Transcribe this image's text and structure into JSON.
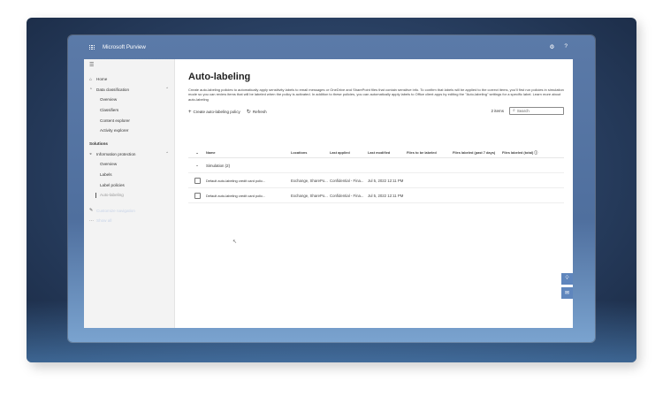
{
  "app": {
    "title": "Microsoft Purview",
    "settings_icon": "gear-icon",
    "help_label": "?"
  },
  "sidebar": {
    "menu_icon": "hamburger-icon",
    "items": [
      {
        "label": "Home",
        "icon": "home-icon"
      },
      {
        "label": "Data classification",
        "icon": "classification-icon"
      },
      {
        "label": "Overview"
      },
      {
        "label": "Classifiers"
      },
      {
        "label": "Content explorer"
      },
      {
        "label": "Activity explorer"
      },
      {
        "label": "Solutions"
      },
      {
        "label": "Information protection",
        "icon": "shield-icon"
      },
      {
        "label": "Overview"
      },
      {
        "label": "Labels"
      },
      {
        "label": "Label policies"
      },
      {
        "label": "Auto-labeling"
      },
      {
        "label": "Customize navigation",
        "icon": "edit-icon"
      },
      {
        "label": "Show all"
      }
    ]
  },
  "page": {
    "title": "Auto-labeling",
    "description": "Create auto-labeling policies to automatically apply sensitivity labels to email messages or OneDrive and SharePoint files that contain sensitive info. To confirm that labels will be applied to the correct items, you'll first run policies in simulation mode so you can review items that will be labeled when the policy is activated. In addition to these policies, you can automatically apply labels to Office client apps by editing the \"Auto-labeling\" settings for a specific label. Learn more about auto-labeling"
  },
  "toolbar": {
    "create_label": "Create auto-labeling policy",
    "refresh_label": "Refresh",
    "count_label": "2 items",
    "search_placeholder": "Search"
  },
  "table": {
    "columns": [
      "Name",
      "Locations",
      "Last applied",
      "Last modified",
      "Files to be labeled",
      "Files labeled (past 7 days)",
      "Files labeled (total)"
    ],
    "group_label": "Simulation (2)",
    "rows": [
      {
        "name": "Default auto-labeling credit card polic...",
        "locations": "Exchange, SharePo...",
        "last_applied": "Confidential - Fina...",
        "last_modified": "Jul 5, 2022 12:11 PM"
      },
      {
        "name": "Default auto-labeling credit card polic...",
        "locations": "Exchange, SharePo...",
        "last_applied": "Confidential - Fina...",
        "last_modified": "Jul 5, 2022 12:11 PM"
      }
    ]
  },
  "colors": {
    "accent": "#5f86bd",
    "frame": "#2c4468"
  }
}
